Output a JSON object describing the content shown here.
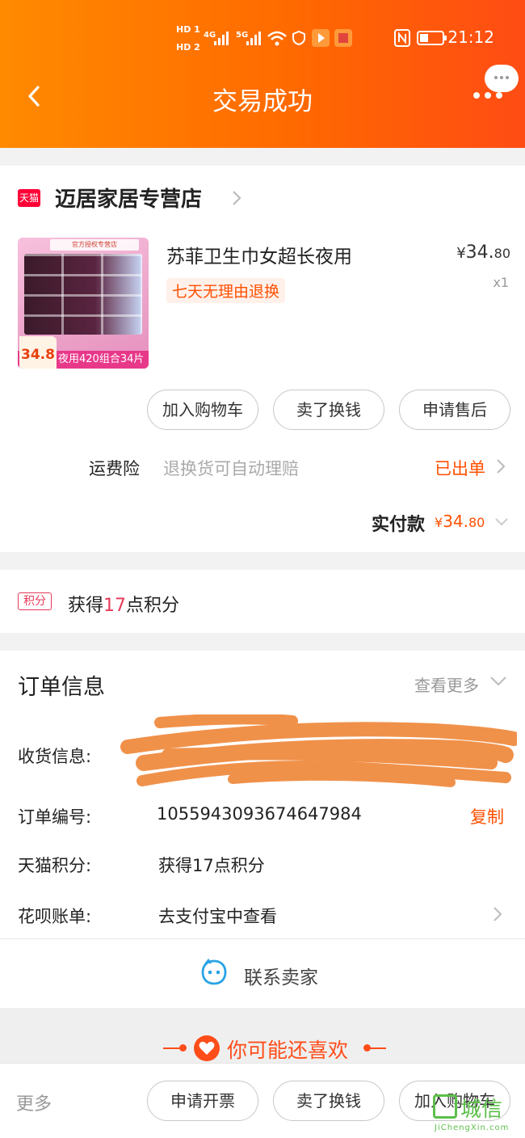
{
  "status_bar": {
    "hd1": "HD 1",
    "hd2": "HD 2",
    "net1": "4G",
    "net2": "5G",
    "time": "21:12"
  },
  "header": {
    "title": "交易成功"
  },
  "store": {
    "badge": "天猫",
    "name": "迈居家居专营店"
  },
  "product": {
    "title": "苏菲卫生巾女超长夜用",
    "price_currency": "¥",
    "price_int": "34.",
    "price_dec": "80",
    "quantity": "x1",
    "return_tag": "七天无理由退换",
    "thumb_banner": "夜用420组合34片",
    "thumb_price": "34.8",
    "thumb_top": "官方授权专营店"
  },
  "actions": {
    "add_cart": "加入购物车",
    "resell": "卖了换钱",
    "after_sale": "申请售后"
  },
  "insurance": {
    "label": "运费险",
    "desc": "退换货可自动理赔",
    "status": "已出单"
  },
  "payment": {
    "label": "实付款",
    "currency": "¥",
    "amount_int": "34.",
    "amount_dec": "80"
  },
  "points": {
    "badge": "积分",
    "prefix": "获得",
    "value": "17",
    "suffix": "点积分"
  },
  "order_info": {
    "title": "订单信息",
    "see_more": "查看更多",
    "address_label": "收货信息:",
    "order_no_label": "订单编号:",
    "order_no": "1055943093674647984",
    "copy": "复制",
    "tmall_points_label": "天猫积分:",
    "tmall_points_value": "获得17点积分",
    "huabei_label": "花呗账单:",
    "huabei_value": "去支付宝中查看"
  },
  "contact": {
    "label": "联系卖家"
  },
  "recommend": {
    "title": "你可能还喜欢"
  },
  "bottom_bar": {
    "more": "更多",
    "invoice": "申请开票",
    "resell": "卖了换钱",
    "add_cart": "加入购物车"
  },
  "watermark": {
    "cn": "城信",
    "en": "JiChengXin.com"
  },
  "colors": {
    "header_start": "#ff8a00",
    "header_end": "#ff4c14",
    "accent": "#ff5000",
    "points": "#e63a5a",
    "scribble": "#f0914a"
  }
}
